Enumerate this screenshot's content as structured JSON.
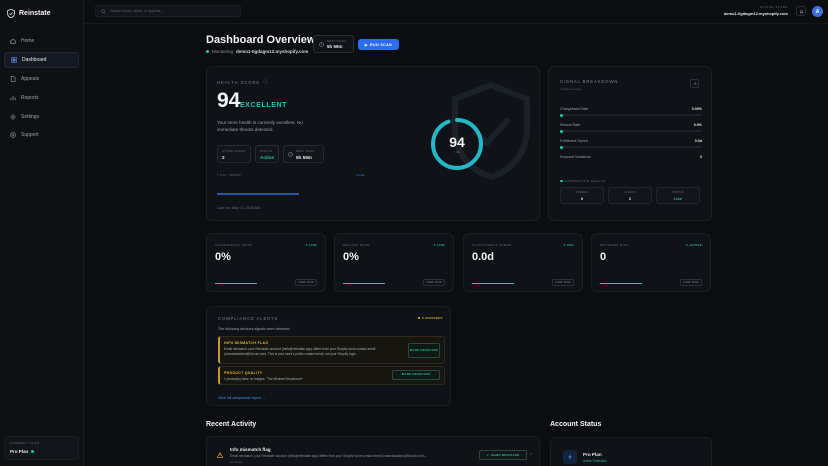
{
  "app": {
    "name": "Reinstate"
  },
  "colors": {
    "accent": "#2c6cf0",
    "teal": "#22c5b8",
    "success": "#22c59a",
    "warning": "#e8b930",
    "background": "#0b0d10"
  },
  "sidebar": {
    "items": [
      {
        "label": "Home",
        "icon": "home-icon",
        "active": false
      },
      {
        "label": "Dashboard",
        "icon": "dashboard-icon",
        "active": true
      },
      {
        "label": "Appeals",
        "icon": "document-icon",
        "active": false
      },
      {
        "label": "Reports",
        "icon": "reports-icon",
        "active": false
      },
      {
        "label": "Settings",
        "icon": "gear-icon",
        "active": false
      },
      {
        "label": "Support",
        "icon": "help-icon",
        "active": false
      }
    ],
    "plan": {
      "caption": "CURRENT PLAN",
      "name": "Pro Plan"
    }
  },
  "topbar": {
    "search_placeholder": "Search stores, alerts, or appeals...",
    "store_caption": "ACTIVE STORE",
    "store_name": "demo1-0gdagm12.myshopify.com"
  },
  "user": {
    "initial": "A"
  },
  "header": {
    "title": "Dashboard Overview",
    "monitoring_prefix": "Monitoring",
    "monitoring_store": "demo1-0gdagm12.myshopify.com",
    "next_scan_caption": "NEXT SCAN",
    "next_scan_value": "5h 59m",
    "run_scan_label": "RUN SCAN"
  },
  "health": {
    "label": "HEALTH SCORE",
    "score": "94",
    "score_value": 94,
    "status": "EXCELLENT",
    "description": "Your store health is currently excellent. No immediate threats detected.",
    "stats": [
      {
        "caption": "STORE SCANS",
        "value": "2"
      },
      {
        "caption": "STATUS",
        "value": "Active"
      },
      {
        "caption": "NEXT SCAN",
        "value": "5h 59m"
      }
    ],
    "trend_label": "7 DAY TREND",
    "trend_value": "+0 pts",
    "last_run": "Last run: May 10, 2025 AM",
    "ring_sub": "/ 100"
  },
  "signal": {
    "title": "SIGNAL BREAKDOWN",
    "subtitle": "7 days overview",
    "metrics": [
      {
        "label": "Chargeback Rate",
        "value": "0.00%"
      },
      {
        "label": "Refund Rate",
        "value": "0.0%"
      },
      {
        "label": "Fulfillment Speed",
        "value": "0.0d"
      },
      {
        "label": "Keyword Violations",
        "value": "0"
      }
    ],
    "connection_label": "CONNECTION HEALTH",
    "connection": [
      {
        "caption": "ORDERS",
        "value": "0"
      },
      {
        "caption": "ALERTS",
        "value": "2"
      },
      {
        "caption": "STATUS",
        "value": "Live"
      }
    ]
  },
  "mini_cards": [
    {
      "caption": "CHARGEBACK RATE",
      "badge": "↗ LIVE",
      "value": "0%",
      "button": "VIEW RISK"
    },
    {
      "caption": "REFUND RATE",
      "badge": "↗ LIVE",
      "value": "0%",
      "button": "VIEW RISK"
    },
    {
      "caption": "FULFILLMENT SPEED",
      "badge": "↗ AVG",
      "value": "0.0d",
      "button": "VIEW RISK"
    },
    {
      "caption": "NETWORK RISK",
      "badge": "↗ ACTIVE",
      "value": "0",
      "button": "VIEW RISK"
    }
  ],
  "compliance": {
    "title": "COMPLIANCE ALERTS",
    "badge": "2 ADVISORY",
    "description": "The following advisory signals were detected:",
    "alerts": [
      {
        "title": "INFO MISMATCH FLAG",
        "body": "Email mismatch: your Reinstate account (hello@reinstate.app) differs from your Shopify store contact email (chasealdarland@icloud.com). This is your store's public contact email, not your Shopify login.",
        "button": "MARK RESOLVED"
      },
      {
        "title": "PRODUCT QUALITY",
        "body": "1 product(s) have no images: \"The Minimal Snowboard\"",
        "button": "MARK RESOLVED"
      }
    ],
    "view_link": "View full compliance report →"
  },
  "activity": {
    "title": "Recent Activity",
    "item": {
      "title": "Info mismatch flag",
      "body": "Email mismatch: your Reinstate account (hello@reinstate.app) differs from your Shopify store contact email (chasealdarland@icloud.com)...",
      "sub": "12 minutes",
      "button": "MARK RESOLVED"
    }
  },
  "account": {
    "title": "Account Status",
    "plan_name": "Pro Plan",
    "plan_status": "Active Protection"
  }
}
